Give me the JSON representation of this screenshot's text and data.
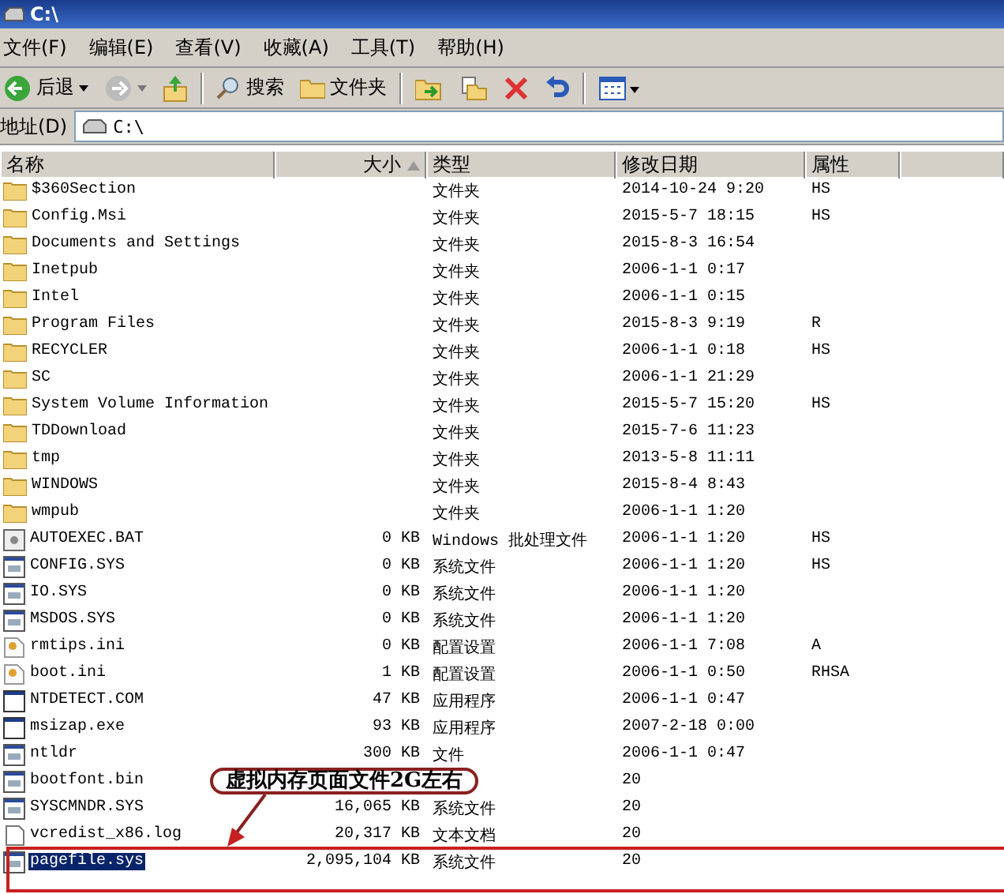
{
  "window": {
    "title": "C:\\"
  },
  "menu": [
    {
      "label": "文件(F)"
    },
    {
      "label": "编辑(E)"
    },
    {
      "label": "查看(V)"
    },
    {
      "label": "收藏(A)"
    },
    {
      "label": "工具(T)"
    },
    {
      "label": "帮助(H)"
    }
  ],
  "toolbar": {
    "back": "后退",
    "search": "搜索",
    "folders": "文件夹"
  },
  "address": {
    "label": "地址(D)",
    "value": "C:\\"
  },
  "columns": [
    {
      "label": "名称",
      "sorted": false
    },
    {
      "label": "大小",
      "sorted": true
    },
    {
      "label": "类型",
      "sorted": false
    },
    {
      "label": "修改日期",
      "sorted": false
    },
    {
      "label": "属性",
      "sorted": false
    }
  ],
  "rows": [
    {
      "kind": "folder",
      "name": "$360Section",
      "size": "",
      "type": "文件夹",
      "date": "2014-10-24 9:20",
      "attr": "HS",
      "selected": false
    },
    {
      "kind": "folder",
      "name": "Config.Msi",
      "size": "",
      "type": "文件夹",
      "date": "2015-5-7 18:15",
      "attr": "HS",
      "selected": false
    },
    {
      "kind": "folder",
      "name": "Documents and Settings",
      "size": "",
      "type": "文件夹",
      "date": "2015-8-3 16:54",
      "attr": "",
      "selected": false
    },
    {
      "kind": "folder",
      "name": "Inetpub",
      "size": "",
      "type": "文件夹",
      "date": "2006-1-1 0:17",
      "attr": "",
      "selected": false
    },
    {
      "kind": "folder",
      "name": "Intel",
      "size": "",
      "type": "文件夹",
      "date": "2006-1-1 0:15",
      "attr": "",
      "selected": false
    },
    {
      "kind": "folder",
      "name": "Program Files",
      "size": "",
      "type": "文件夹",
      "date": "2015-8-3 9:19",
      "attr": "R",
      "selected": false
    },
    {
      "kind": "folder",
      "name": "RECYCLER",
      "size": "",
      "type": "文件夹",
      "date": "2006-1-1 0:18",
      "attr": "HS",
      "selected": false
    },
    {
      "kind": "folder",
      "name": "SC",
      "size": "",
      "type": "文件夹",
      "date": "2006-1-1 21:29",
      "attr": "",
      "selected": false
    },
    {
      "kind": "folder",
      "name": "System Volume Information",
      "size": "",
      "type": "文件夹",
      "date": "2015-5-7 15:20",
      "attr": "HS",
      "selected": false
    },
    {
      "kind": "folder",
      "name": "TDDownload",
      "size": "",
      "type": "文件夹",
      "date": "2015-7-6 11:23",
      "attr": "",
      "selected": false
    },
    {
      "kind": "folder",
      "name": "tmp",
      "size": "",
      "type": "文件夹",
      "date": "2013-5-8 11:11",
      "attr": "",
      "selected": false
    },
    {
      "kind": "folder",
      "name": "WINDOWS",
      "size": "",
      "type": "文件夹",
      "date": "2015-8-4 8:43",
      "attr": "",
      "selected": false
    },
    {
      "kind": "folder",
      "name": "wmpub",
      "size": "",
      "type": "文件夹",
      "date": "2006-1-1 1:20",
      "attr": "",
      "selected": false
    },
    {
      "kind": "batch",
      "name": "AUTOEXEC.BAT",
      "size": "0 KB",
      "type": "Windows 批处理文件",
      "date": "2006-1-1 1:20",
      "attr": "HS",
      "selected": false
    },
    {
      "kind": "system",
      "name": "CONFIG.SYS",
      "size": "0 KB",
      "type": "系统文件",
      "date": "2006-1-1 1:20",
      "attr": "HS",
      "selected": false
    },
    {
      "kind": "system",
      "name": "IO.SYS",
      "size": "0 KB",
      "type": "系统文件",
      "date": "2006-1-1 1:20",
      "attr": "",
      "selected": false
    },
    {
      "kind": "system",
      "name": "MSDOS.SYS",
      "size": "0 KB",
      "type": "系统文件",
      "date": "2006-1-1 1:20",
      "attr": "",
      "selected": false
    },
    {
      "kind": "settings",
      "name": "rmtips.ini",
      "size": "0 KB",
      "type": "配置设置",
      "date": "2006-1-1 7:08",
      "attr": "A",
      "selected": false
    },
    {
      "kind": "settings",
      "name": "boot.ini",
      "size": "1 KB",
      "type": "配置设置",
      "date": "2006-1-1 0:50",
      "attr": "RHSA",
      "selected": false
    },
    {
      "kind": "program",
      "name": "NTDETECT.COM",
      "size": "47 KB",
      "type": "应用程序",
      "date": "2006-1-1 0:47",
      "attr": "",
      "selected": false
    },
    {
      "kind": "program",
      "name": "msizap.exe",
      "size": "93 KB",
      "type": "应用程序",
      "date": "2007-2-18 0:00",
      "attr": "",
      "selected": false
    },
    {
      "kind": "system",
      "name": "ntldr",
      "size": "300 KB",
      "type": "文件",
      "date": "2006-1-1 0:47",
      "attr": "",
      "selected": false
    },
    {
      "kind": "system",
      "name": "bootfont.bin",
      "size": "",
      "type": "",
      "date": "20",
      "attr": "",
      "selected": false
    },
    {
      "kind": "system",
      "name": "SYSCMNDR.SYS",
      "size": "16,065 KB",
      "type": "系统文件",
      "date": "20",
      "attr": "",
      "selected": false
    },
    {
      "kind": "text",
      "name": "vcredist_x86.log",
      "size": "20,317 KB",
      "type": "文本文档",
      "date": "20",
      "attr": "",
      "selected": false
    },
    {
      "kind": "system",
      "name": "pagefile.sys",
      "size": "2,095,104 KB",
      "type": "系统文件",
      "date": "20",
      "attr": "",
      "selected": true
    }
  ],
  "callout": {
    "text": "虚拟内存页面文件2G左右"
  }
}
